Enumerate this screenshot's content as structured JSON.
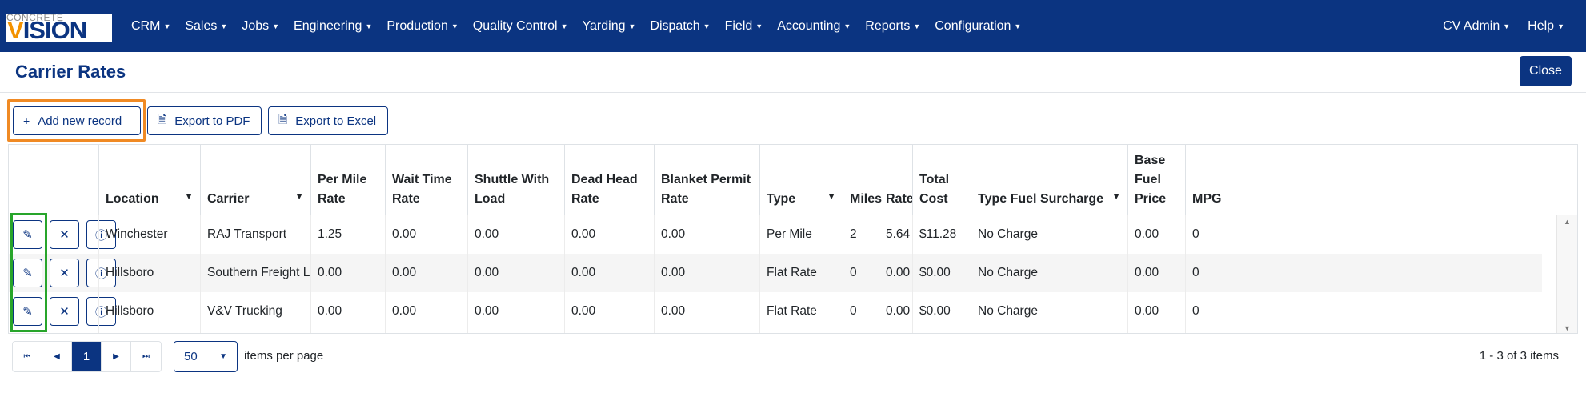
{
  "navbar": {
    "logo_top": "CONCRETE",
    "logo_v": "V",
    "logo_rest": "ISION",
    "menu": [
      "CRM",
      "Sales",
      "Jobs",
      "Engineering",
      "Production",
      "Quality Control",
      "Yarding",
      "Dispatch",
      "Field",
      "Accounting",
      "Reports",
      "Configuration"
    ],
    "user": "CV Admin",
    "help": "Help",
    "caret": "▼"
  },
  "page": {
    "title": "Carrier Rates",
    "close_label": "Close"
  },
  "toolbar": {
    "add_label": "Add new record",
    "add_icon": "+",
    "pdf_label": "Export to PDF",
    "pdf_icon": "🗎",
    "excel_label": "Export to Excel",
    "excel_icon": "🗎"
  },
  "grid": {
    "filter_icon": "▼",
    "columns": [
      {
        "label": "Location",
        "filter": true
      },
      {
        "label": "Carrier",
        "filter": true
      },
      {
        "label": "Per Mile Rate",
        "filter": false
      },
      {
        "label": "Wait Time Rate",
        "filter": false
      },
      {
        "label": "Shuttle With Load",
        "filter": false
      },
      {
        "label": "Dead Head Rate",
        "filter": false
      },
      {
        "label": "Blanket Permit Rate",
        "filter": false
      },
      {
        "label": "Type",
        "filter": true
      },
      {
        "label": "Miles",
        "filter": false
      },
      {
        "label": "Rate",
        "filter": false
      },
      {
        "label": "Total Cost",
        "filter": false
      },
      {
        "label": "Type Fuel Surcharge",
        "filter": true
      },
      {
        "label": "Base Fuel Price",
        "filter": false
      },
      {
        "label": "MPG",
        "filter": false
      }
    ],
    "rows": [
      [
        "Winchester",
        "RAJ Transport",
        "1.25",
        "0.00",
        "0.00",
        "0.00",
        "0.00",
        "Per Mile",
        "2",
        "5.64",
        "$11.28",
        "No Charge",
        "0.00",
        "0"
      ],
      [
        "Hillsboro",
        "Southern Freight Lines",
        "0.00",
        "0.00",
        "0.00",
        "0.00",
        "0.00",
        "Flat Rate",
        "0",
        "0.00",
        "$0.00",
        "No Charge",
        "0.00",
        "0"
      ],
      [
        "Hillsboro",
        "V&V Trucking",
        "0.00",
        "0.00",
        "0.00",
        "0.00",
        "0.00",
        "Flat Rate",
        "0",
        "0.00",
        "$0.00",
        "No Charge",
        "0.00",
        "0"
      ]
    ],
    "row_icons": {
      "edit": "✎",
      "delete": "✕",
      "info": "ⓘ"
    }
  },
  "pager": {
    "first": "⏮",
    "prev": "◀",
    "current": "1",
    "next": "▶",
    "last": "⏭",
    "page_size": "50",
    "page_size_caret": "▼",
    "items_per_page": "items per page",
    "info": "1 - 3 of 3 items"
  },
  "colors": {
    "brand": "#0b3481",
    "accent_orange": "#f08a24",
    "highlight_green": "#28a52b"
  }
}
